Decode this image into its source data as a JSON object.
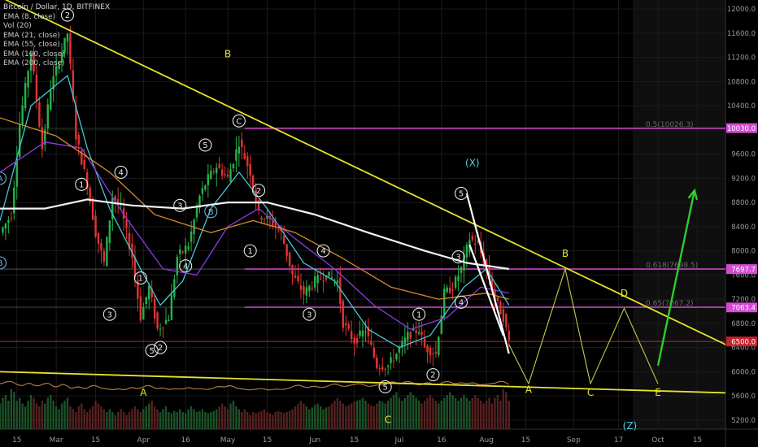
{
  "chart_title": "Bitcoin / Dollar, 1D, BITFINEX",
  "indicators": [
    "Vol (20)",
    "EMA (8, close)",
    "EMA (21, close)",
    "EMA (55, close)",
    "EMA (100, close)",
    "EMA (200, close)"
  ],
  "colors": {
    "up": "#27b24a",
    "down": "#e03434",
    "trendline": "#e6e32a",
    "fib": "#d34bd3",
    "projection": "#c8c84a",
    "arrow": "#2ecc2e",
    "label_yellow": "#e6e32a",
    "label_cyan": "#4fd0e0",
    "price_tag_red": "#c4232d"
  },
  "chart_data": {
    "type": "candlestick",
    "symbol": "Bitcoin / Dollar",
    "timeframe": "1D",
    "exchange": "BITFINEX",
    "x_axis": {
      "ticks": [
        {
          "label": "15",
          "date": "2018-02-15"
        },
        {
          "label": "Mar",
          "date": "2018-03-01"
        },
        {
          "label": "15",
          "date": "2018-03-15"
        },
        {
          "label": "Apr",
          "date": "2018-04-01"
        },
        {
          "label": "16",
          "date": "2018-04-16"
        },
        {
          "label": "May",
          "date": "2018-05-01"
        },
        {
          "label": "15",
          "date": "2018-05-15"
        },
        {
          "label": "Jun",
          "date": "2018-06-01"
        },
        {
          "label": "15",
          "date": "2018-06-15"
        },
        {
          "label": "Jul",
          "date": "2018-07-01"
        },
        {
          "label": "16",
          "date": "2018-07-16"
        },
        {
          "label": "Aug",
          "date": "2018-08-01"
        },
        {
          "label": "15",
          "date": "2018-08-15"
        },
        {
          "label": "Sep",
          "date": "2018-09-01"
        },
        {
          "label": "17",
          "date": "2018-09-17"
        },
        {
          "label": "Oct",
          "date": "2018-10-01"
        },
        {
          "label": "15",
          "date": "2018-10-15"
        }
      ],
      "range": [
        "2018-02-09",
        "2018-10-25"
      ]
    },
    "y_axis": {
      "ticks": [
        "12000.0",
        "11600.0",
        "11200.0",
        "10800.0",
        "10400.0",
        "10000.0",
        "9600.0",
        "9200.0",
        "8800.0",
        "8400.0",
        "8000.0",
        "7600.0",
        "7200.0",
        "6800.0",
        "6400.0",
        "6000.0",
        "5600.0",
        "5200.0"
      ],
      "range": [
        5050,
        12150
      ]
    },
    "price_tags": [
      {
        "value": 10030,
        "label": "10030.0",
        "color": "#d34bd3"
      },
      {
        "value": 7697.7,
        "label": "7697.7",
        "color": "#d34bd3"
      },
      {
        "value": 7063.4,
        "label": "7063.4",
        "color": "#d34bd3"
      },
      {
        "value": 6500,
        "label": "6500.0",
        "color": "#c4232d"
      }
    ],
    "fib_levels": [
      {
        "value": 10026.3,
        "label": "0.5(10026.3)"
      },
      {
        "value": 7698.5,
        "label": "0.618(7698.5)"
      },
      {
        "value": 7067.2,
        "label": "0.65(7067.2)"
      }
    ],
    "price_path": [
      [
        "2018-02-09",
        8300
      ],
      [
        "2018-02-13",
        8600
      ],
      [
        "2018-02-16",
        10100
      ],
      [
        "2018-02-20",
        11300
      ],
      [
        "2018-02-24",
        9700
      ],
      [
        "2018-02-27",
        10700
      ],
      [
        "2018-03-01",
        11000
      ],
      [
        "2018-03-05",
        11600
      ],
      [
        "2018-03-08",
        9900
      ],
      [
        "2018-03-12",
        9100
      ],
      [
        "2018-03-15",
        8300
      ],
      [
        "2018-03-18",
        7800
      ],
      [
        "2018-03-21",
        8900
      ],
      [
        "2018-03-24",
        8700
      ],
      [
        "2018-03-28",
        7900
      ],
      [
        "2018-03-31",
        6900
      ],
      [
        "2018-04-03",
        7400
      ],
      [
        "2018-04-06",
        6700
      ],
      [
        "2018-04-10",
        6900
      ],
      [
        "2018-04-13",
        7900
      ],
      [
        "2018-04-17",
        8100
      ],
      [
        "2018-04-21",
        8900
      ],
      [
        "2018-04-24",
        9200
      ],
      [
        "2018-04-27",
        9400
      ],
      [
        "2018-05-01",
        9200
      ],
      [
        "2018-05-05",
        9800
      ],
      [
        "2018-05-09",
        9300
      ],
      [
        "2018-05-12",
        8600
      ],
      [
        "2018-05-16",
        8500
      ],
      [
        "2018-05-20",
        8300
      ],
      [
        "2018-05-24",
        7600
      ],
      [
        "2018-05-28",
        7300
      ],
      [
        "2018-06-01",
        7500
      ],
      [
        "2018-06-05",
        7600
      ],
      [
        "2018-06-09",
        7500
      ],
      [
        "2018-06-11",
        6800
      ],
      [
        "2018-06-15",
        6500
      ],
      [
        "2018-06-19",
        6700
      ],
      [
        "2018-06-23",
        6100
      ],
      [
        "2018-06-27",
        6100
      ],
      [
        "2018-06-30",
        6300
      ],
      [
        "2018-07-04",
        6600
      ],
      [
        "2018-07-08",
        6700
      ],
      [
        "2018-07-10",
        6400
      ],
      [
        "2018-07-14",
        6300
      ],
      [
        "2018-07-17",
        7300
      ],
      [
        "2018-07-20",
        7400
      ],
      [
        "2018-07-23",
        7700
      ],
      [
        "2018-07-26",
        8200
      ],
      [
        "2018-07-29",
        8100
      ],
      [
        "2018-08-01",
        7700
      ],
      [
        "2018-08-04",
        7200
      ],
      [
        "2018-08-07",
        6900
      ],
      [
        "2018-08-09",
        6500
      ]
    ],
    "ema_fast": [
      [
        "2018-02-09",
        8500
      ],
      [
        "2018-02-20",
        10400
      ],
      [
        "2018-03-05",
        10900
      ],
      [
        "2018-03-12",
        9700
      ],
      [
        "2018-03-20",
        8700
      ],
      [
        "2018-03-31",
        7700
      ],
      [
        "2018-04-07",
        7100
      ],
      [
        "2018-04-15",
        7500
      ],
      [
        "2018-04-25",
        8700
      ],
      [
        "2018-05-05",
        9300
      ],
      [
        "2018-05-15",
        8700
      ],
      [
        "2018-05-28",
        7800
      ],
      [
        "2018-06-08",
        7500
      ],
      [
        "2018-06-20",
        6700
      ],
      [
        "2018-07-01",
        6400
      ],
      [
        "2018-07-12",
        6600
      ],
      [
        "2018-07-24",
        7400
      ],
      [
        "2018-08-01",
        7700
      ],
      [
        "2018-08-09",
        7100
      ]
    ],
    "ema_mid": [
      [
        "2018-02-09",
        9300
      ],
      [
        "2018-02-25",
        9800
      ],
      [
        "2018-03-10",
        9700
      ],
      [
        "2018-03-25",
        8600
      ],
      [
        "2018-04-08",
        7700
      ],
      [
        "2018-04-20",
        7600
      ],
      [
        "2018-05-01",
        8400
      ],
      [
        "2018-05-12",
        8700
      ],
      [
        "2018-05-25",
        8200
      ],
      [
        "2018-06-08",
        7700
      ],
      [
        "2018-06-22",
        7100
      ],
      [
        "2018-07-05",
        6700
      ],
      [
        "2018-07-18",
        6900
      ],
      [
        "2018-07-30",
        7400
      ],
      [
        "2018-08-09",
        7300
      ]
    ],
    "ema_slow": [
      [
        "2018-02-09",
        10200
      ],
      [
        "2018-03-01",
        9900
      ],
      [
        "2018-03-20",
        9300
      ],
      [
        "2018-04-05",
        8600
      ],
      [
        "2018-04-25",
        8300
      ],
      [
        "2018-05-10",
        8500
      ],
      [
        "2018-05-25",
        8300
      ],
      [
        "2018-06-10",
        7900
      ],
      [
        "2018-06-28",
        7400
      ],
      [
        "2018-07-15",
        7200
      ],
      [
        "2018-08-01",
        7300
      ],
      [
        "2018-08-09",
        7200
      ]
    ],
    "ema_200": [
      [
        "2018-02-09",
        8700
      ],
      [
        "2018-02-25",
        8700
      ],
      [
        "2018-03-12",
        8850
      ],
      [
        "2018-03-28",
        8750
      ],
      [
        "2018-04-15",
        8700
      ],
      [
        "2018-05-01",
        8800
      ],
      [
        "2018-05-15",
        8800
      ],
      [
        "2018-06-01",
        8600
      ],
      [
        "2018-06-20",
        8300
      ],
      [
        "2018-07-10",
        8000
      ],
      [
        "2018-07-25",
        7800
      ],
      [
        "2018-08-09",
        7700
      ]
    ],
    "trendlines": [
      {
        "from": [
          "2018-02-09",
          12200
        ],
        "to": [
          "2018-10-25",
          6450
        ]
      },
      {
        "from": [
          "2018-02-09",
          6000
        ],
        "to": [
          "2018-10-25",
          5650
        ]
      },
      {
        "from": [
          "2018-07-25",
          8950
        ],
        "to": [
          "2018-08-09",
          6300
        ]
      },
      {
        "from": [
          "2018-07-26",
          8100
        ],
        "to": [
          "2018-08-07",
          6600
        ]
      }
    ],
    "projection_path": [
      [
        "2018-08-09",
        6450
      ],
      [
        "2018-08-16",
        5800
      ],
      [
        "2018-08-29",
        7700
      ],
      [
        "2018-09-07",
        5800
      ],
      [
        "2018-09-19",
        7050
      ],
      [
        "2018-10-01",
        5800
      ]
    ],
    "arrow": {
      "from": [
        "2018-10-01",
        6100
      ],
      "to": [
        "2018-10-14",
        9000
      ]
    },
    "wave_labels": [
      {
        "text": "A",
        "date": "2018-02-09",
        "value": 9200,
        "style": "circle-cyan"
      },
      {
        "text": "B",
        "date": "2018-02-09",
        "value": 7800,
        "style": "circle-cyan"
      },
      {
        "text": "1",
        "date": "2018-03-10",
        "value": 9100,
        "style": "circle"
      },
      {
        "text": "2",
        "date": "2018-03-05",
        "value": 11900,
        "style": "circle"
      },
      {
        "text": "3",
        "date": "2018-03-20",
        "value": 6950,
        "style": "circle"
      },
      {
        "text": "4",
        "date": "2018-03-24",
        "value": 9300,
        "style": "circle"
      },
      {
        "text": "1",
        "date": "2018-03-31",
        "value": 7550,
        "style": "circle"
      },
      {
        "text": "5",
        "date": "2018-04-04",
        "value": 6350,
        "style": "circle"
      },
      {
        "text": "2",
        "date": "2018-04-07",
        "value": 6400,
        "style": "circle"
      },
      {
        "text": "3",
        "date": "2018-04-14",
        "value": 8750,
        "style": "circle"
      },
      {
        "text": "4",
        "date": "2018-04-16",
        "value": 7750,
        "style": "circle"
      },
      {
        "text": "5",
        "date": "2018-04-23",
        "value": 9750,
        "style": "circle"
      },
      {
        "text": "B",
        "date": "2018-04-25",
        "value": 8650,
        "style": "circle-cyan"
      },
      {
        "text": "C",
        "date": "2018-05-05",
        "value": 10150,
        "style": "circle"
      },
      {
        "text": "2",
        "date": "2018-05-12",
        "value": 9000,
        "style": "circle"
      },
      {
        "text": "1",
        "date": "2018-05-09",
        "value": 8000,
        "style": "circle"
      },
      {
        "text": "3",
        "date": "2018-05-30",
        "value": 6950,
        "style": "circle"
      },
      {
        "text": "4",
        "date": "2018-06-04",
        "value": 8000,
        "style": "circle"
      },
      {
        "text": "5",
        "date": "2018-06-26",
        "value": 5750,
        "style": "circle"
      },
      {
        "text": "1",
        "date": "2018-07-08",
        "value": 6950,
        "style": "circle"
      },
      {
        "text": "2",
        "date": "2018-07-13",
        "value": 5950,
        "style": "circle"
      },
      {
        "text": "3",
        "date": "2018-07-22",
        "value": 7900,
        "style": "circle"
      },
      {
        "text": "4",
        "date": "2018-07-23",
        "value": 7150,
        "style": "circle"
      },
      {
        "text": "5",
        "date": "2018-07-23",
        "value": 8950,
        "style": "circle"
      },
      {
        "text": "B",
        "date": "2018-05-01",
        "value": 11200,
        "style": "plain-yellow"
      },
      {
        "text": "(X)",
        "date": "2018-07-27",
        "value": 9400,
        "style": "plain-cyan"
      },
      {
        "text": "A",
        "date": "2018-04-01",
        "value": 5600,
        "style": "plain-yellow"
      },
      {
        "text": "C",
        "date": "2018-06-27",
        "value": 5150,
        "style": "plain-yellow"
      },
      {
        "text": "A",
        "date": "2018-08-16",
        "value": 5650,
        "style": "plain-yellow"
      },
      {
        "text": "B",
        "date": "2018-08-29",
        "value": 7900,
        "style": "plain-yellow"
      },
      {
        "text": "C",
        "date": "2018-09-07",
        "value": 5600,
        "style": "plain-yellow"
      },
      {
        "text": "D",
        "date": "2018-09-19",
        "value": 7240,
        "style": "plain-yellow"
      },
      {
        "text": "E",
        "date": "2018-10-01",
        "value": 5600,
        "style": "plain-yellow"
      },
      {
        "text": "(Z)",
        "date": "2018-09-21",
        "value": 5050,
        "style": "plain-cyan"
      }
    ],
    "volume": {
      "note": "volume histogram at bottom; relative heights 0-1",
      "values": [
        0.45,
        0.55,
        0.6,
        0.5,
        0.7,
        0.65,
        0.5,
        0.55,
        0.45,
        0.4,
        0.5,
        0.6,
        0.55,
        0.45,
        0.4,
        0.5,
        0.45,
        0.55,
        0.6,
        0.5,
        0.4,
        0.35,
        0.45,
        0.5,
        0.55,
        0.4,
        0.35,
        0.3,
        0.4,
        0.45,
        0.35,
        0.3,
        0.35,
        0.4,
        0.5,
        0.45,
        0.4,
        0.35,
        0.3,
        0.35,
        0.3,
        0.25,
        0.3,
        0.35,
        0.3,
        0.25,
        0.3,
        0.35,
        0.4,
        0.35,
        0.3,
        0.35,
        0.4,
        0.45,
        0.5,
        0.4,
        0.35,
        0.3,
        0.35,
        0.4,
        0.3,
        0.28,
        0.32,
        0.3,
        0.35,
        0.3,
        0.28,
        0.35,
        0.4,
        0.35,
        0.3,
        0.32,
        0.35,
        0.3,
        0.28,
        0.3,
        0.32,
        0.35,
        0.4,
        0.45,
        0.4,
        0.35,
        0.45,
        0.5,
        0.4,
        0.35,
        0.3,
        0.35,
        0.3,
        0.25,
        0.3,
        0.28,
        0.3,
        0.32,
        0.35,
        0.3,
        0.28,
        0.25,
        0.3,
        0.32,
        0.3,
        0.28,
        0.3,
        0.32,
        0.35,
        0.4,
        0.45,
        0.5,
        0.45,
        0.4,
        0.35,
        0.38,
        0.42,
        0.45,
        0.4,
        0.35,
        0.38,
        0.4,
        0.45,
        0.5,
        0.55,
        0.5,
        0.45,
        0.4,
        0.42,
        0.45,
        0.48,
        0.5,
        0.52,
        0.55,
        0.5,
        0.45,
        0.42,
        0.4,
        0.45,
        0.5,
        0.48,
        0.45,
        0.5,
        0.55,
        0.6,
        0.65,
        0.55,
        0.5,
        0.55,
        0.6,
        0.65,
        0.6,
        0.55,
        0.5,
        0.45,
        0.5,
        0.55,
        0.6,
        0.55,
        0.5,
        0.45,
        0.5,
        0.55,
        0.6,
        0.65,
        0.6,
        0.55,
        0.5,
        0.55,
        0.6,
        0.55,
        0.5,
        0.55,
        0.6,
        0.55,
        0.5,
        0.45,
        0.5,
        0.55
      ]
    }
  }
}
